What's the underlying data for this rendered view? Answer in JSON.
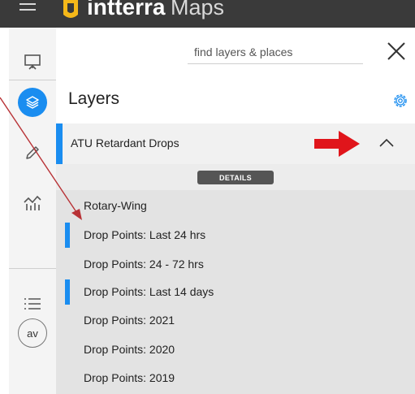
{
  "app": {
    "brand_name": "intterra",
    "brand_sub": "Maps"
  },
  "rail": {
    "items": [
      {
        "icon": "presentation-icon"
      },
      {
        "icon": "layers-icon",
        "active": true
      },
      {
        "icon": "pencil-icon"
      },
      {
        "icon": "analytics-icon"
      },
      {
        "icon": "list-icon"
      }
    ],
    "avatar_initials": "av"
  },
  "search": {
    "placeholder": "find layers & places",
    "value": ""
  },
  "panel": {
    "title": "Layers"
  },
  "layer_group": {
    "label": "ATU Retardant Drops",
    "details_label": "DETAILS",
    "expanded": true
  },
  "layers": [
    {
      "label": "Rotary-Wing",
      "active": false
    },
    {
      "label": "Drop Points: Last 24 hrs",
      "active": true
    },
    {
      "label": "Drop Points: 24 - 72 hrs",
      "active": false
    },
    {
      "label": "Drop Points: Last 14 days",
      "active": true
    },
    {
      "label": "Drop Points: 2021",
      "active": false
    },
    {
      "label": "Drop Points: 2020",
      "active": false
    },
    {
      "label": "Drop Points: 2019",
      "active": false
    }
  ],
  "colors": {
    "accent": "#1a8df0",
    "annotation_arrow": "#e0151b",
    "annotation_line": "#b83236"
  }
}
